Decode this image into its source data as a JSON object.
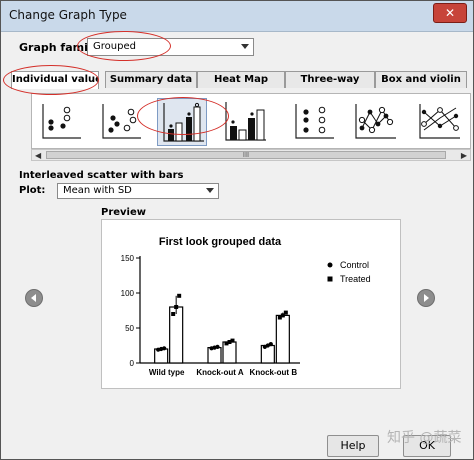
{
  "window": {
    "title": "Change Graph Type",
    "close_label": "✕"
  },
  "graph_family": {
    "label": "Graph family:",
    "value": "Grouped"
  },
  "tabs": [
    {
      "label": "Individual values",
      "active": true
    },
    {
      "label": "Summary data",
      "active": false
    },
    {
      "label": "Heat Map",
      "active": false
    },
    {
      "label": "Three-way",
      "active": false
    },
    {
      "label": "Box and violin",
      "active": false
    }
  ],
  "gallery": {
    "thumbnails": [
      "scatter-icon",
      "scatter-spread-icon",
      "interleaved-scatter-bars-icon",
      "scatter-bars-icon",
      "column-scatter-icon",
      "connected-scatter-icon",
      "before-after-icon"
    ],
    "selected_index": 2,
    "scroll_grip": "III"
  },
  "graph_type_name": "Interleaved scatter with bars",
  "plot": {
    "label": "Plot:",
    "value": "Mean with SD"
  },
  "preview": {
    "label": "Preview",
    "chart_data": {
      "type": "bar",
      "title": "First look grouped data",
      "categories": [
        "Wild type",
        "Knock-out A",
        "Knock-out B"
      ],
      "series": [
        {
          "name": "Control",
          "values": [
            20,
            22,
            25
          ],
          "marker": "circle"
        },
        {
          "name": "Treated",
          "values": [
            80,
            30,
            68
          ],
          "marker": "square"
        }
      ],
      "points": [
        [
          [
            19,
            20,
            21
          ],
          [
            70,
            80,
            96
          ]
        ],
        [
          [
            21,
            22,
            23
          ],
          [
            28,
            30,
            32
          ]
        ],
        [
          [
            23,
            25,
            27
          ],
          [
            65,
            68,
            72
          ]
        ]
      ],
      "ylim": [
        0,
        150
      ],
      "yticks": [
        0,
        50,
        100,
        150
      ],
      "legend_position": "top-right"
    }
  },
  "buttons": {
    "help": "Help",
    "ok": "OK"
  },
  "watermark": "知乎 @蔬菜"
}
